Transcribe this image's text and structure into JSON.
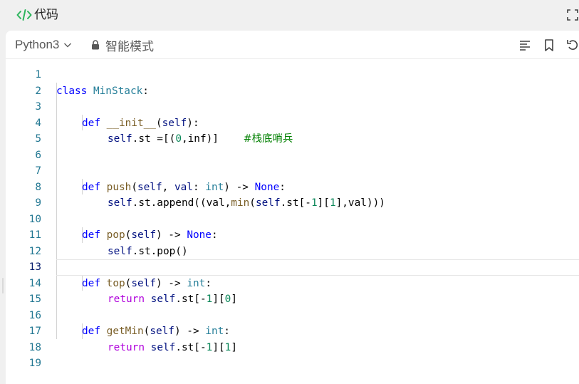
{
  "title": {
    "text": "代码"
  },
  "toolbar": {
    "language": "Python3",
    "mode_label": "智能模式"
  },
  "editor": {
    "line_numbers": [
      "1",
      "2",
      "3",
      "4",
      "5",
      "6",
      "7",
      "8",
      "9",
      "10",
      "11",
      "12",
      "13",
      "14",
      "15",
      "16",
      "17",
      "18",
      "19"
    ],
    "current_line": 13,
    "code": {
      "l1_kw": "class ",
      "l1_cls": "MinStack",
      "l1_rest": ":",
      "l3_kw": "def ",
      "l3_fn": "__init__",
      "l3_p1": "(",
      "l3_self": "self",
      "l3_p2": "):",
      "l4_self": "self",
      "l4_a": ".st =[(",
      "l4_num": "0",
      "l4_b": ",inf)]    ",
      "l4_cmt": "#栈底哨兵",
      "l7_kw": "def ",
      "l7_fn": "push",
      "l7_p1": "(",
      "l7_self": "self",
      "l7_p2": ", ",
      "l7_val": "val",
      "l7_p3": ": ",
      "l7_type": "int",
      "l7_p4": ") -> ",
      "l7_none": "None",
      "l7_p5": ":",
      "l8_self": "self",
      "l8_a": ".st.append((val,",
      "l8_min": "min",
      "l8_b": "(",
      "l8_self2": "self",
      "l8_c": ".st[-",
      "l8_n1": "1",
      "l8_d": "][",
      "l8_n2": "1",
      "l8_e": "],val)))",
      "l10_kw": "def ",
      "l10_fn": "pop",
      "l10_p1": "(",
      "l10_self": "self",
      "l10_p2": ") -> ",
      "l10_none": "None",
      "l10_p3": ":",
      "l11_self": "self",
      "l11_a": ".st.pop()",
      "l13_kw": "def ",
      "l13_fn": "top",
      "l13_p1": "(",
      "l13_self": "self",
      "l13_p2": ") -> ",
      "l13_type": "int",
      "l13_p3": ":",
      "l14_ret": "return ",
      "l14_self": "self",
      "l14_a": ".st[-",
      "l14_n1": "1",
      "l14_b": "][",
      "l14_n2": "0",
      "l14_c": "]",
      "l16_kw": "def ",
      "l16_fn": "getMin",
      "l16_p1": "(",
      "l16_self": "self",
      "l16_p2": ") -> ",
      "l16_type": "int",
      "l16_p3": ":",
      "l17_ret": "return ",
      "l17_self": "self",
      "l17_a": ".st[-",
      "l17_n1": "1",
      "l17_b": "][",
      "l17_n2": "1",
      "l17_c": "]"
    }
  },
  "icons": {
    "title_icon": "code-icon",
    "fullscreen": "fullscreen-icon",
    "language_dropdown": "chevron-down-icon",
    "mode": "lock-icon",
    "format": "format-align-icon",
    "bookmark": "bookmark-icon",
    "reset": "undo-icon"
  },
  "colors": {
    "title_icon": "#2db55d",
    "keyword": "#0000ff",
    "class_name": "#267f99",
    "function": "#795e26",
    "self": "#001080",
    "number": "#098658",
    "comment": "#008000",
    "control": "#af00db",
    "line_number": "#237893"
  }
}
